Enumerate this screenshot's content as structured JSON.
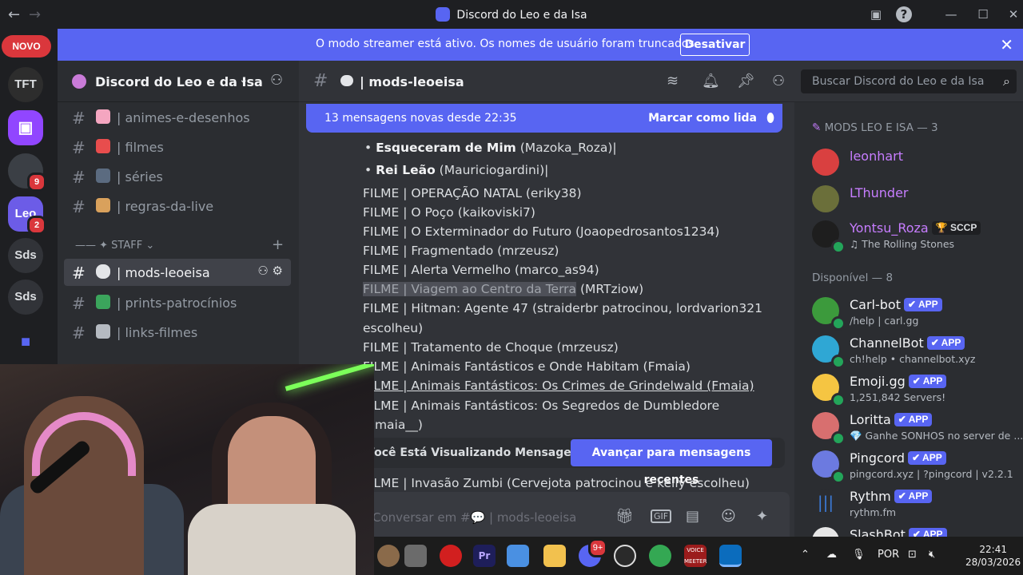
{
  "window": {
    "title": "Discord do Leo e da Isa",
    "back": "←",
    "forward": "→"
  },
  "banner": {
    "message": "O modo streamer está ativo. Os nomes de usuário foram truncados.",
    "button": "Desativar",
    "close": "✕"
  },
  "rail": {
    "novo": "NOVO",
    "servers": [
      {
        "label": "TFT",
        "color": "#2d2d2d"
      },
      {
        "label": "",
        "color": "#9146ff"
      },
      {
        "label": "",
        "color": "#3b3f45",
        "badge": "9"
      },
      {
        "label": "Leo",
        "color": "#6c5ce7",
        "badge": "2"
      },
      {
        "label": "Sds",
        "color": "#313338"
      },
      {
        "label": "Sds",
        "color": "#313338"
      }
    ]
  },
  "guild": {
    "name": "Discord do Leo e da Isa"
  },
  "channels": [
    {
      "name": "animes-e-desenhos",
      "emoji_color": "#f4a6c0"
    },
    {
      "name": "filmes",
      "emoji_color": "#e84d4d"
    },
    {
      "name": "séries",
      "emoji_color": "#5b6b80"
    },
    {
      "name": "regras-da-live",
      "emoji_color": "#d9a15c"
    }
  ],
  "category": "✦ STAFF",
  "staff_channels": [
    {
      "name": "mods-leoeisa",
      "emoji_color": "#e3e5e8",
      "active": true
    },
    {
      "name": "prints-patrocínios",
      "emoji_color": "#3ba55c"
    },
    {
      "name": "links-filmes",
      "emoji_color": "#b5bac1"
    }
  ],
  "chat_header": {
    "channel": "mods-leoeisa"
  },
  "search": {
    "placeholder": "Buscar Discord do Leo e da Isa"
  },
  "new_messages": {
    "text": "13 mensagens novas desde 22:35",
    "mark_read": "Marcar como lida"
  },
  "messages": {
    "bullets": [
      {
        "bold": "Esqueceram de Mim",
        "rest": " (Mazoka_Roza)|"
      },
      {
        "bold": "Rei Leão",
        "rest": " (Mauriciogardini)|"
      }
    ],
    "lines": [
      "FILME | OPERAÇÃO NATAL (eriky38)",
      "FILME | O Poço (kaikoviski7)",
      "FILME | O Exterminador do Futuro (Joaopedrosantos1234)",
      "FILME | Fragmentado (mrzeusz)",
      "FILME | Alerta Vermelho (marco_as94)"
    ],
    "highlight_a": "FILME | Viagem ao Centro da Terra",
    "highlight_b": " (MRTziow)",
    "hitman_1": "FILME | Hitman: Agente 47 (straiderbr patrocinou, lordvarion321",
    "hitman_2": "escolheu)",
    "tratamento": "FILME | Tratamento de Choque (mrzeusz)",
    "animais1": "FILME | Animais Fantásticos e Onde Habitam (Fmaia)",
    "animais2": "FILME | Animais Fantásticos: Os Crimes de Grindelwald (Fmaia)",
    "animais3a": "FILME | Animais Fantásticos: Os Segredos de Dumbledore",
    "animais3b": "(Fmaia__)",
    "zumbi": "FILME | Invasão Zumbi (Cervejota patrocinou e kelly escolheu)"
  },
  "old_messages": {
    "text": "Você Está Visualizando Mensagens Antigas",
    "button": "Avançar para mensagens recentes"
  },
  "composer": {
    "placeholder": "Conversar em #💬 | mods-leoeisa"
  },
  "members": {
    "group1": "MODS LEO E ISA — 3",
    "mods": [
      {
        "name": "leonhart",
        "color": "#c77dff",
        "avatar": "#d94040"
      },
      {
        "name": "LThunder",
        "color": "#c77dff",
        "avatar": "#6b6f3a"
      },
      {
        "name": "Yontsu_Roza",
        "color": "#c77dff",
        "avatar": "#1e1e1e",
        "tag": "🏆 SCCP",
        "sub": "♫ The Rolling Stones"
      }
    ],
    "group2": "Disponível — 8",
    "bots": [
      {
        "name": "Carl-bot",
        "sub": "/help | carl.gg",
        "avatar": "#3c9a3c"
      },
      {
        "name": "ChannelBot",
        "sub": "ch!help • channelbot.xyz",
        "avatar": "#2fa7d4"
      },
      {
        "name": "Emoji.gg",
        "sub": "1,251,842 Servers!",
        "avatar": "#f5c542"
      },
      {
        "name": "Loritta",
        "sub": "💎 Ganhe SONHOS no server de ...",
        "avatar": "#d86f6f"
      },
      {
        "name": "Pingcord",
        "sub": "pingcord.xyz | ?pingcord | v2.2.1",
        "avatar": "#6c7ae0"
      },
      {
        "name": "Rythm",
        "sub": "rythm.fm",
        "avatar": "#2b2d31"
      },
      {
        "name": "SlashBot",
        "sub": "",
        "avatar": "#e6e6e6"
      }
    ],
    "app_label": "✔ APP"
  },
  "taskbar": {
    "lang": "POR",
    "time": "22:41",
    "date": "28/03/2026",
    "discord_badge": "9+"
  }
}
